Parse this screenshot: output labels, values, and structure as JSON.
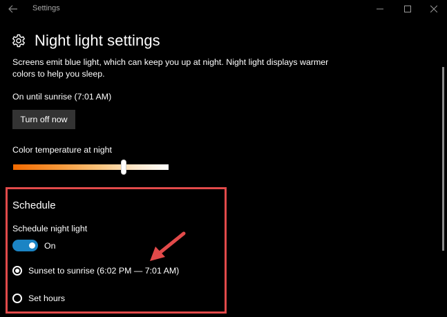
{
  "window": {
    "title": "Settings"
  },
  "page": {
    "title": "Night light settings",
    "description": "Screens emit blue light, which can keep you up at night. Night light displays warmer colors to help you sleep.",
    "status": "On until sunrise (7:01 AM)",
    "turn_off_label": "Turn off now"
  },
  "color_temperature": {
    "label": "Color temperature at night",
    "level_fraction": 0.71
  },
  "schedule": {
    "heading": "Schedule",
    "toggle_label": "Schedule night light",
    "toggle_state": "On",
    "options": [
      {
        "label": "Sunset to sunrise (6:02 PM — 7:01 AM)",
        "selected": true
      },
      {
        "label": "Set hours",
        "selected": false
      }
    ]
  },
  "colors": {
    "accent": "#1b84c4",
    "highlight_box": "#e24a4a",
    "background": "#000000"
  },
  "icons": {
    "back": "back-arrow-icon",
    "settings": "gear-icon",
    "minimize": "minimize-icon",
    "maximize": "maximize-icon",
    "close": "close-icon",
    "annotation": "annotation-arrow-icon"
  }
}
